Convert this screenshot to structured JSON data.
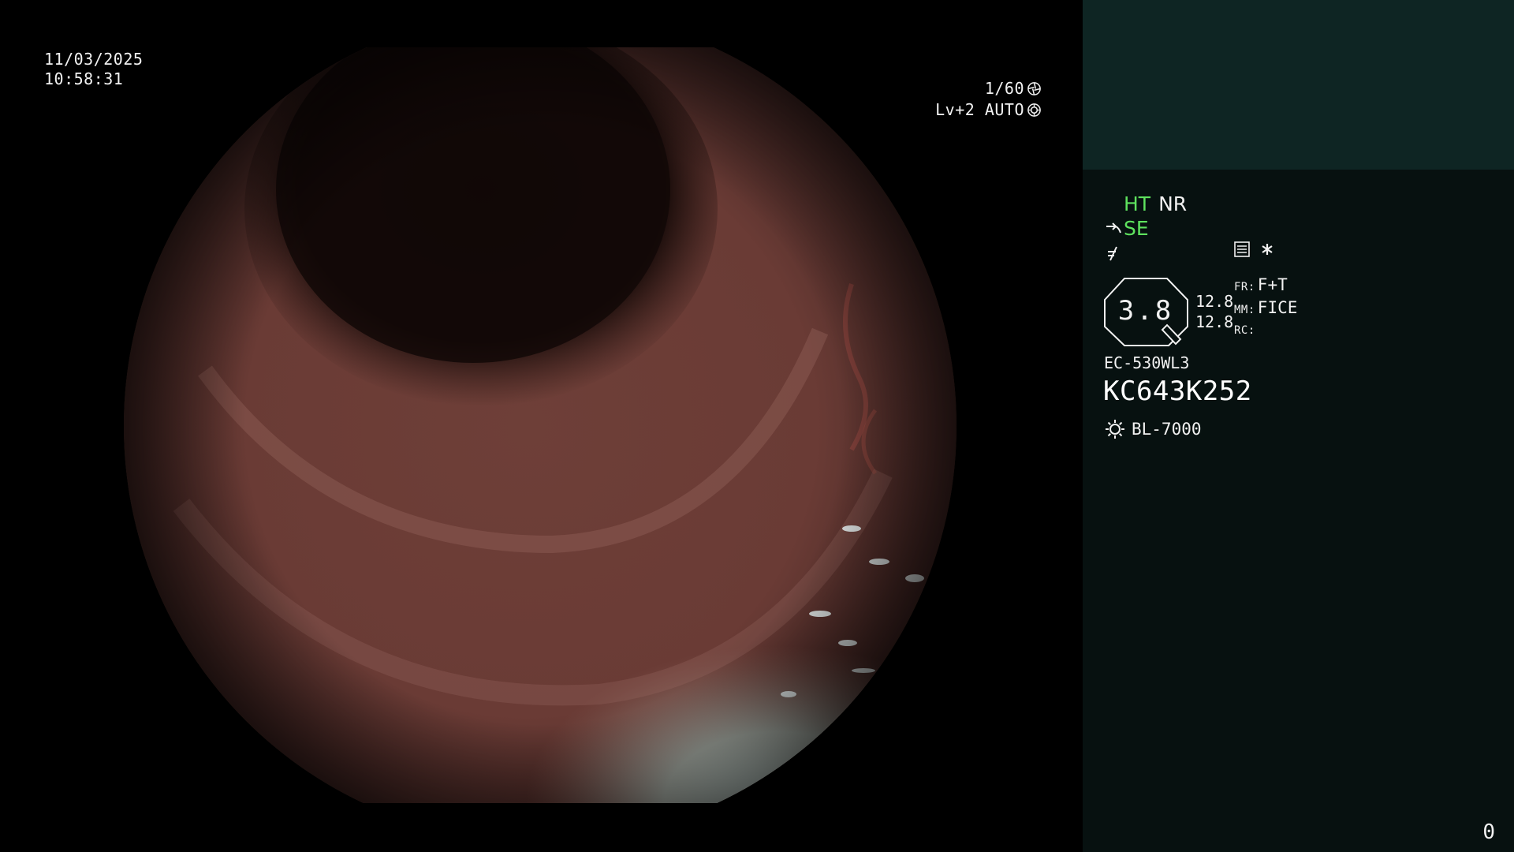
{
  "overlay": {
    "date": "11/03/2025",
    "time": "10:58:31",
    "shutter": "1/60",
    "level_mode": "Lv+2 AUTO"
  },
  "panel": {
    "mode_ht": "HT",
    "mode_nr": "NR",
    "mode_se": "SE",
    "zoom_value": "3.8",
    "readout_1": "12.8",
    "readout_2": "12.8",
    "fr_label": "FR:",
    "fr_value": "F+T",
    "mm_label": "MM:",
    "mm_value": "FICE",
    "rc_label": "RC:",
    "rc_value": "",
    "scope_model": "EC-530WL3",
    "scope_serial": "KC643K252",
    "light_source": "BL-7000",
    "counter": "0"
  },
  "colors": {
    "mode_active": "#5ee25e",
    "text": "#f2f2f2",
    "panel_bg": "#071110",
    "thumbnail_bg": "#0e2523"
  },
  "icons": [
    "shutter-icon",
    "auto-iris-icon",
    "structure-enhance-icon",
    "color-enhance-icon",
    "menu-list-icon",
    "asterisk-icon",
    "zoom-octagon-icon",
    "light-source-icon"
  ]
}
